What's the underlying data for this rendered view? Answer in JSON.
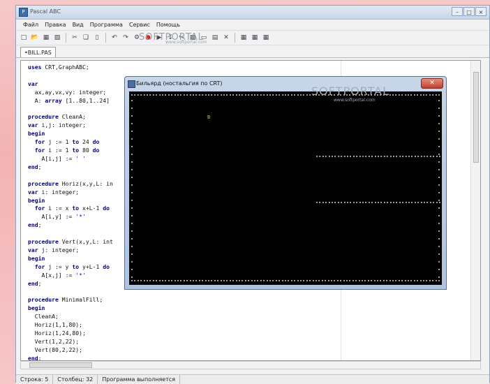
{
  "window": {
    "title": "Pascal ABC",
    "controls": [
      "–",
      "□",
      "×"
    ]
  },
  "menu": [
    "Файл",
    "Правка",
    "Вид",
    "Программа",
    "Сервис",
    "Помощь"
  ],
  "toolbar_icons": [
    "new-file-icon",
    "open-icon",
    "save-icon",
    "save-all-icon",
    "cut-icon",
    "copy-icon",
    "paste-icon",
    "undo-icon",
    "redo-icon",
    "run-icon",
    "step-icon",
    "step-into-icon",
    "stop-icon",
    "compile-icon",
    "window-icon",
    "form-icon",
    "close-icon",
    "watch-icon",
    "grid-icon",
    "grid2-icon"
  ],
  "watermark": {
    "text": "SOFTPORTAL",
    "sub": "www.softportal.com"
  },
  "tab": {
    "label": "•BILL.PAS"
  },
  "code_lines": [
    [
      [
        "kw",
        "uses"
      ],
      [
        "t",
        " CRT,GraphABC;"
      ]
    ],
    [
      [
        "t",
        ""
      ]
    ],
    [
      [
        "kw",
        "var"
      ]
    ],
    [
      [
        "t",
        "  ax,ay,vx,vy: integer;"
      ]
    ],
    [
      [
        "t",
        "  A: "
      ],
      [
        "kw",
        "array"
      ],
      [
        "t",
        " [1..80,1..24]"
      ]
    ],
    [
      [
        "t",
        ""
      ]
    ],
    [
      [
        "kw",
        "procedure"
      ],
      [
        "t",
        " CleanA;"
      ]
    ],
    [
      [
        "kw",
        "var"
      ],
      [
        "t",
        " i,j: integer;"
      ]
    ],
    [
      [
        "kw",
        "begin"
      ]
    ],
    [
      [
        "t",
        "  "
      ],
      [
        "kw",
        "for"
      ],
      [
        "t",
        " j := 1 "
      ],
      [
        "kw",
        "to"
      ],
      [
        "t",
        " 24 "
      ],
      [
        "kw",
        "do"
      ]
    ],
    [
      [
        "t",
        "  "
      ],
      [
        "kw",
        "for"
      ],
      [
        "t",
        " i := 1 "
      ],
      [
        "kw",
        "to"
      ],
      [
        "t",
        " 80 "
      ],
      [
        "kw",
        "do"
      ]
    ],
    [
      [
        "t",
        "    A[i,j] := "
      ],
      [
        "str",
        "' '"
      ]
    ],
    [
      [
        "kw",
        "end"
      ],
      [
        "t",
        ";"
      ]
    ],
    [
      [
        "t",
        ""
      ]
    ],
    [
      [
        "kw",
        "procedure"
      ],
      [
        "t",
        " Horiz(x,y,L: in"
      ]
    ],
    [
      [
        "kw",
        "var"
      ],
      [
        "t",
        " i: integer;"
      ]
    ],
    [
      [
        "kw",
        "begin"
      ]
    ],
    [
      [
        "t",
        "  "
      ],
      [
        "kw",
        "for"
      ],
      [
        "t",
        " i := x "
      ],
      [
        "kw",
        "to"
      ],
      [
        "t",
        " x+L-1 "
      ],
      [
        "kw",
        "do"
      ]
    ],
    [
      [
        "t",
        "    A[i,y] := "
      ],
      [
        "str",
        "'*'"
      ]
    ],
    [
      [
        "kw",
        "end"
      ],
      [
        "t",
        ";"
      ]
    ],
    [
      [
        "t",
        ""
      ]
    ],
    [
      [
        "kw",
        "procedure"
      ],
      [
        "t",
        " Vert(x,y,L: int"
      ]
    ],
    [
      [
        "kw",
        "var"
      ],
      [
        "t",
        " j: integer;"
      ]
    ],
    [
      [
        "kw",
        "begin"
      ]
    ],
    [
      [
        "t",
        "  "
      ],
      [
        "kw",
        "for"
      ],
      [
        "t",
        " j := y "
      ],
      [
        "kw",
        "to"
      ],
      [
        "t",
        " y+L-1 "
      ],
      [
        "kw",
        "do"
      ]
    ],
    [
      [
        "t",
        "    A[x,j] := "
      ],
      [
        "str",
        "'*'"
      ]
    ],
    [
      [
        "kw",
        "end"
      ],
      [
        "t",
        ";"
      ]
    ],
    [
      [
        "t",
        ""
      ]
    ],
    [
      [
        "kw",
        "procedure"
      ],
      [
        "t",
        " MinimalFill;"
      ]
    ],
    [
      [
        "kw",
        "begin"
      ]
    ],
    [
      [
        "t",
        "  CleanA;"
      ]
    ],
    [
      [
        "t",
        "  Horiz(1,1,80);"
      ]
    ],
    [
      [
        "t",
        "  Horiz(1,24,80);"
      ]
    ],
    [
      [
        "t",
        "  Vert(1,2,22);"
      ]
    ],
    [
      [
        "t",
        "  Vert(80,2,22);"
      ]
    ],
    [
      [
        "kw",
        "end"
      ],
      [
        "t",
        ";"
      ]
    ]
  ],
  "dialog": {
    "title": "Бильярд (ностальгия по CRT)",
    "close": "✕",
    "ball_char": "B"
  },
  "status": {
    "row": "Строка: 5",
    "col": "Столбец: 32",
    "state": "Программа выполняется"
  }
}
